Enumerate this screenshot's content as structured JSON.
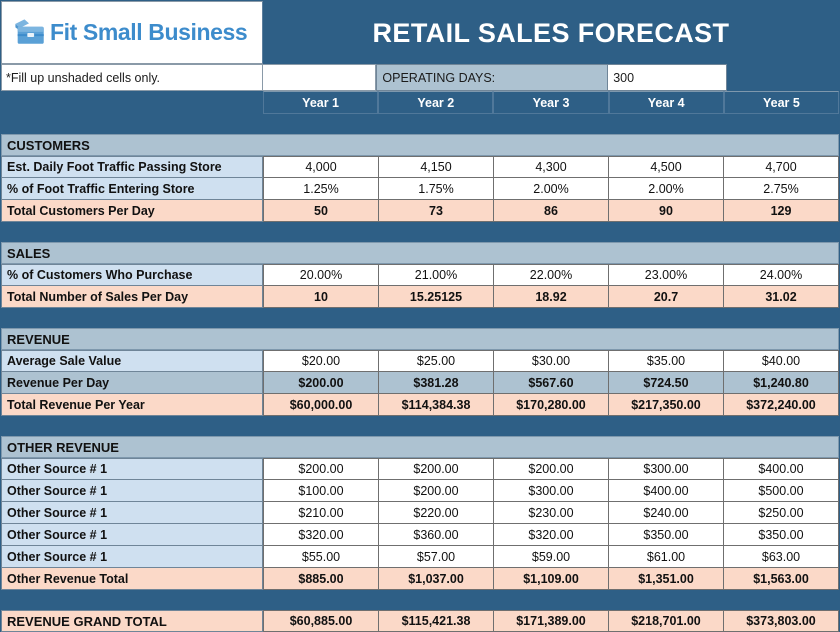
{
  "header": {
    "logo_text": "Fit Small Business",
    "logo_icon": "briefcase-icon",
    "title": "RETAIL SALES FORECAST"
  },
  "subheader": {
    "note": "*Fill up unshaded cells only.",
    "operating_days_label": "OPERATING DAYS:",
    "operating_days_value": "300"
  },
  "columns": [
    "Year 1",
    "Year 2",
    "Year 3",
    "Year 4",
    "Year 5"
  ],
  "colors": {
    "brand_blue": "#2e5f86",
    "logo_blue": "#3d8ccc",
    "section_header": "#adc2d1",
    "input_row": "#cfe0f0",
    "total_row": "#fbd9c8",
    "calc_row": "#adc2d1",
    "white_cell": "#ffffff"
  },
  "sections": [
    {
      "name": "CUSTOMERS",
      "rows": [
        {
          "label": "Est. Daily Foot Traffic Passing Store",
          "label_tint": "t-blue",
          "value_tint": "t-white",
          "bold_values": false,
          "values": [
            "4,000",
            "4,150",
            "4,300",
            "4,500",
            "4,700"
          ]
        },
        {
          "label": "% of Foot Traffic Entering Store",
          "label_tint": "t-blue",
          "value_tint": "t-white",
          "bold_values": false,
          "values": [
            "1.25%",
            "1.75%",
            "2.00%",
            "2.00%",
            "2.75%"
          ]
        },
        {
          "label": "Total Customers Per Day",
          "label_tint": "t-peach",
          "value_tint": "t-peach",
          "bold_values": true,
          "values": [
            "50",
            "73",
            "86",
            "90",
            "129"
          ]
        }
      ]
    },
    {
      "name": "SALES",
      "rows": [
        {
          "label": "% of Customers Who Purchase",
          "label_tint": "t-blue",
          "value_tint": "t-white",
          "bold_values": false,
          "values": [
            "20.00%",
            "21.00%",
            "22.00%",
            "23.00%",
            "24.00%"
          ]
        },
        {
          "label": "Total Number of Sales Per Day",
          "label_tint": "t-peach",
          "value_tint": "t-peach",
          "bold_values": true,
          "values": [
            "10",
            "15.25125",
            "18.92",
            "20.7",
            "31.02"
          ]
        }
      ]
    },
    {
      "name": "REVENUE",
      "rows": [
        {
          "label": "Average Sale Value",
          "label_tint": "t-blue",
          "value_tint": "t-white",
          "bold_values": false,
          "values": [
            "$20.00",
            "$25.00",
            "$30.00",
            "$35.00",
            "$40.00"
          ]
        },
        {
          "label": "Revenue Per Day",
          "label_tint": "t-steel",
          "value_tint": "t-steel",
          "bold_values": true,
          "values": [
            "$200.00",
            "$381.28",
            "$567.60",
            "$724.50",
            "$1,240.80"
          ]
        },
        {
          "label": "Total Revenue Per Year",
          "label_tint": "t-peach",
          "value_tint": "t-peach",
          "bold_values": true,
          "values": [
            "$60,000.00",
            "$114,384.38",
            "$170,280.00",
            "$217,350.00",
            "$372,240.00"
          ]
        }
      ]
    },
    {
      "name": "OTHER REVENUE",
      "rows": [
        {
          "label": "Other Source # 1",
          "label_tint": "t-blue",
          "value_tint": "t-white",
          "bold_values": false,
          "values": [
            "$200.00",
            "$200.00",
            "$200.00",
            "$300.00",
            "$400.00"
          ]
        },
        {
          "label": "Other Source # 1",
          "label_tint": "t-blue",
          "value_tint": "t-white",
          "bold_values": false,
          "values": [
            "$100.00",
            "$200.00",
            "$300.00",
            "$400.00",
            "$500.00"
          ]
        },
        {
          "label": "Other Source # 1",
          "label_tint": "t-blue",
          "value_tint": "t-white",
          "bold_values": false,
          "values": [
            "$210.00",
            "$220.00",
            "$230.00",
            "$240.00",
            "$250.00"
          ]
        },
        {
          "label": "Other Source # 1",
          "label_tint": "t-blue",
          "value_tint": "t-white",
          "bold_values": false,
          "values": [
            "$320.00",
            "$360.00",
            "$320.00",
            "$350.00",
            "$350.00"
          ]
        },
        {
          "label": "Other Source # 1",
          "label_tint": "t-blue",
          "value_tint": "t-white",
          "bold_values": false,
          "values": [
            "$55.00",
            "$57.00",
            "$59.00",
            "$61.00",
            "$63.00"
          ]
        },
        {
          "label": "Other Revenue Total",
          "label_tint": "t-peach",
          "value_tint": "t-peach",
          "bold_values": true,
          "values": [
            "$885.00",
            "$1,037.00",
            "$1,109.00",
            "$1,351.00",
            "$1,563.00"
          ]
        }
      ]
    }
  ],
  "grand_total": {
    "label": "REVENUE GRAND TOTAL",
    "values": [
      "$60,885.00",
      "$115,421.38",
      "$171,389.00",
      "$218,701.00",
      "$373,803.00"
    ]
  }
}
